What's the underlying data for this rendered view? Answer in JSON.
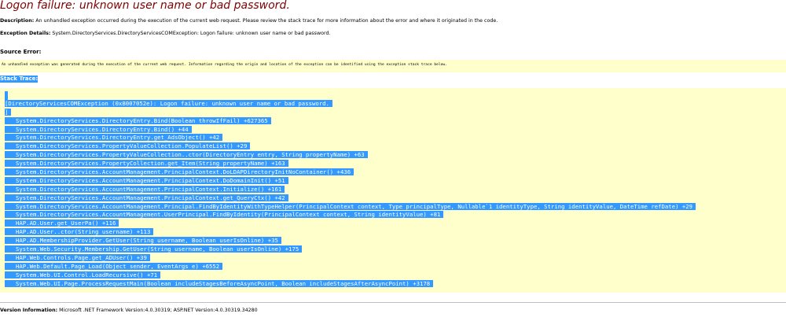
{
  "error": {
    "title": "Logon failure: unknown user name or bad password.",
    "description_label": "Description:",
    "description_text": "An unhandled exception occurred during the execution of the current web request. Please review the stack trace for more information about the error and where it originated in the code.",
    "details_label": "Exception Details:",
    "details_text": "System.DirectoryServices.DirectoryServicesCOMException: Logon failure: unknown user name or bad password."
  },
  "source_error": {
    "label": "Source Error:",
    "text": "An unhandled exception was generated during the execution of the current web request. Information regarding the origin and location of the exception can be identified using the exception stack trace below."
  },
  "stack_trace": {
    "label": "Stack Trace:",
    "exception_line": "[DirectoryServicesCOMException (0x8007052e): Logon failure: unknown user name or bad password.",
    "closing_bracket": "]",
    "frames": [
      "System.DirectoryServices.DirectoryEntry.Bind(Boolean throwIfFail) +627365",
      "System.DirectoryServices.DirectoryEntry.Bind() +44",
      "System.DirectoryServices.DirectoryEntry.get_AdsObject() +42",
      "System.DirectoryServices.PropertyValueCollection.PopulateList() +29",
      "System.DirectoryServices.PropertyValueCollection..ctor(DirectoryEntry entry, String propertyName) +63",
      "System.DirectoryServices.PropertyCollection.get_Item(String propertyName) +163",
      "System.DirectoryServices.AccountManagement.PrincipalContext.DoLDAPDirectoryInitNoContainer() +436",
      "System.DirectoryServices.AccountManagement.PrincipalContext.DoDomainInit() +51",
      "System.DirectoryServices.AccountManagement.PrincipalContext.Initialize() +161",
      "System.DirectoryServices.AccountManagement.PrincipalContext.get_QueryCtx() +42",
      "System.DirectoryServices.AccountManagement.Principal.FindByIdentityWithTypeHelper(PrincipalContext context, Type principalType, Nullable`1 identityType, String identityValue, DateTime refDate) +29",
      "System.DirectoryServices.AccountManagement.UserPrincipal.FindByIdentity(PrincipalContext context, String identityValue) +81",
      "HAP.AD.User.get_UserPa() +116",
      "HAP.AD.User..ctor(String username) +113",
      "HAP.AD.MembershipProvider.GetUser(String username, Boolean userIsOnline) +35",
      "System.Web.Security.Membership.GetUser(String username, Boolean userIsOnline) +175",
      "HAP.Web.Controls.Page.get_ADUser() +39",
      "HAP.Web.Default.Page_Load(Object sender, EventArgs e) +6552",
      "System.Web.UI.Control.LoadRecursive() +71",
      "System.Web.UI.Page.ProcessRequestMain(Boolean includeStagesBeforeAsyncPoint, Boolean includeStagesAfterAsyncPoint) +3178"
    ]
  },
  "version_info": {
    "label": "Version Information:",
    "text": "Microsoft .NET Framework Version:4.0.30319; ASP.NET Version:4.0.30319.34280"
  },
  "colors": {
    "title": "#800000",
    "code_background": "#ffffcc",
    "selection": "#3399ff",
    "selection_text": "#ffffff",
    "divider": "#c0c0c0"
  }
}
